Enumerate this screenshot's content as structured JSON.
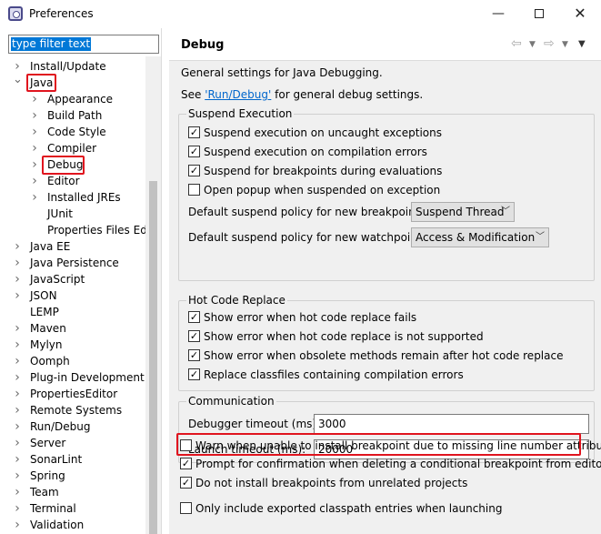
{
  "window": {
    "title": "Preferences",
    "minimize": "—",
    "close": "✕"
  },
  "sidebar": {
    "filter_value": "type filter text",
    "items": [
      {
        "label": "Install/Update",
        "expanded": false,
        "level": 0
      },
      {
        "label": "Java",
        "expanded": true,
        "level": 0
      },
      {
        "label": "Appearance",
        "expanded": false,
        "level": 1
      },
      {
        "label": "Build Path",
        "expanded": false,
        "level": 1
      },
      {
        "label": "Code Style",
        "expanded": false,
        "level": 1
      },
      {
        "label": "Compiler",
        "expanded": false,
        "level": 1
      },
      {
        "label": "Debug",
        "expanded": false,
        "level": 1
      },
      {
        "label": "Editor",
        "expanded": false,
        "level": 1
      },
      {
        "label": "Installed JREs",
        "expanded": false,
        "level": 1
      },
      {
        "label": "JUnit",
        "expanded": null,
        "level": 1
      },
      {
        "label": "Properties Files Editor",
        "expanded": null,
        "level": 1
      },
      {
        "label": "Java EE",
        "expanded": false,
        "level": 0
      },
      {
        "label": "Java Persistence",
        "expanded": false,
        "level": 0
      },
      {
        "label": "JavaScript",
        "expanded": false,
        "level": 0
      },
      {
        "label": "JSON",
        "expanded": false,
        "level": 0
      },
      {
        "label": "LEMP",
        "expanded": null,
        "level": 0
      },
      {
        "label": "Maven",
        "expanded": false,
        "level": 0
      },
      {
        "label": "Mylyn",
        "expanded": false,
        "level": 0
      },
      {
        "label": "Oomph",
        "expanded": false,
        "level": 0
      },
      {
        "label": "Plug-in Development",
        "expanded": false,
        "level": 0
      },
      {
        "label": "PropertiesEditor",
        "expanded": false,
        "level": 0
      },
      {
        "label": "Remote Systems",
        "expanded": false,
        "level": 0
      },
      {
        "label": "Run/Debug",
        "expanded": false,
        "level": 0
      },
      {
        "label": "Server",
        "expanded": false,
        "level": 0
      },
      {
        "label": "SonarLint",
        "expanded": false,
        "level": 0
      },
      {
        "label": "Spring",
        "expanded": false,
        "level": 0
      },
      {
        "label": "Team",
        "expanded": false,
        "level": 0
      },
      {
        "label": "Terminal",
        "expanded": false,
        "level": 0
      },
      {
        "label": "Validation",
        "expanded": false,
        "level": 0
      }
    ]
  },
  "page": {
    "title": "Debug",
    "nav_icons": [
      "back-icon",
      "dropdown-icon",
      "forward-icon",
      "dropdown-icon",
      "menu-icon"
    ],
    "intro": "General settings for Java Debugging.",
    "see_prefix": "See ",
    "see_link": "'Run/Debug'",
    "see_suffix": " for general debug settings.",
    "suspend": {
      "label": "Suspend Execution",
      "options": [
        {
          "label": "Suspend execution on uncaught exceptions",
          "checked": true
        },
        {
          "label": "Suspend execution on compilation errors",
          "checked": true
        },
        {
          "label": "Suspend for breakpoints during evaluations",
          "checked": true
        },
        {
          "label": "Open popup when suspended on exception",
          "checked": false
        }
      ],
      "bp_policy_label": "Default suspend policy for new breakpoints:",
      "bp_policy_value": "Suspend Thread",
      "wp_policy_label": "Default suspend policy for new watchpoints:",
      "wp_policy_value": "Access & Modification"
    },
    "hcr": {
      "label": "Hot Code Replace",
      "options": [
        {
          "label": "Show error when hot code replace fails",
          "checked": true
        },
        {
          "label": "Show error when hot code replace is not supported",
          "checked": true
        },
        {
          "label": "Show error when obsolete methods remain after hot code replace",
          "checked": true
        },
        {
          "label": "Replace classfiles containing compilation errors",
          "checked": true
        }
      ]
    },
    "comm": {
      "label": "Communication",
      "debugger_timeout_label": "Debugger timeout (ms):",
      "debugger_timeout_value": "3000",
      "launch_timeout_label": "Launch timeout (ms):",
      "launch_timeout_value": "20000"
    },
    "bottom_options": [
      {
        "label": "Warn when unable to install breakpoint due to missing line number attributes",
        "checked": false
      },
      {
        "label": "Prompt for confirmation when deleting a conditional breakpoint from editor",
        "checked": true
      },
      {
        "label": "Do not install breakpoints from unrelated projects",
        "checked": true
      },
      {
        "label": "Only include exported classpath entries when launching",
        "checked": false
      }
    ]
  },
  "colors": {
    "highlight_box": "#e0141e",
    "selection": "#0078d7",
    "link": "#0066cc"
  }
}
